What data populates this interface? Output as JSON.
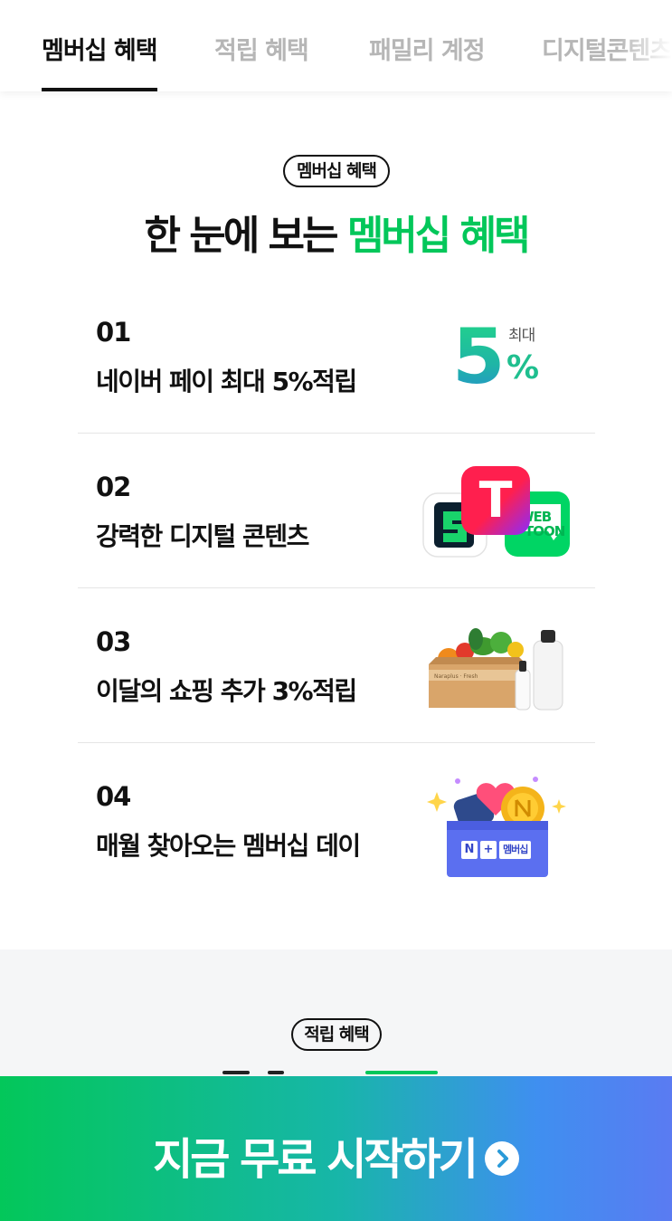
{
  "tabs": [
    {
      "label": "멤버십 혜택",
      "active": true
    },
    {
      "label": "적립 혜택",
      "active": false
    },
    {
      "label": "패밀리 계정",
      "active": false
    },
    {
      "label": "디지털콘텐츠",
      "active": false
    }
  ],
  "section1": {
    "pill": "멤버십 혜택",
    "headline_dark": "한 눈에 보는 ",
    "headline_green": "멤버십 혜택",
    "benefits": [
      {
        "num": "01",
        "text": "네이버 페이 최대 5%적립",
        "art": "five-percent-icon"
      },
      {
        "num": "02",
        "text": "강력한 디지털 콘텐츠",
        "art": "digital-content-apps-icon"
      },
      {
        "num": "03",
        "text": "이달의 쇼핑 추가 3%적립",
        "art": "grocery-box-icon"
      },
      {
        "num": "04",
        "text": "매월 찾아오는 멤버십 데이",
        "art": "gift-box-icon"
      }
    ],
    "five_art": {
      "max_label": "최대",
      "big_digit": "5",
      "percent": "%"
    },
    "apps_art": {
      "t_label": "T",
      "webtoon_top": "WEB",
      "webtoon_bottom": "TOON"
    },
    "box_art": {
      "badge_n": "N",
      "badge_plus": "+",
      "badge_text": "멤버십"
    }
  },
  "section2": {
    "pill": "적립 혜택"
  },
  "cta": {
    "label": "지금 무료 시작하기",
    "icon": "chevron-right-circle-icon"
  },
  "colors": {
    "brand_green": "#03c75a",
    "cta_gradient": [
      "#03c75a",
      "#17b6a8",
      "#3f8ff0",
      "#5a7bf2"
    ]
  }
}
